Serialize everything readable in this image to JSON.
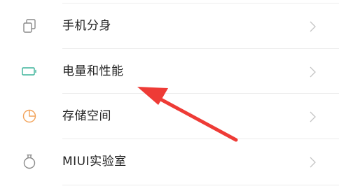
{
  "settings": {
    "items": [
      {
        "label": "手机分身",
        "icon": "clone-icon",
        "icon_color": "#8a8a8a"
      },
      {
        "label": "电量和性能",
        "icon": "battery-icon",
        "icon_color": "#3cb39a"
      },
      {
        "label": "存储空间",
        "icon": "pie-chart-icon",
        "icon_color": "#f2a35a"
      },
      {
        "label": "MIUI实验室",
        "icon": "flask-icon",
        "icon_color": "#8a8a8a"
      }
    ]
  },
  "annotation": {
    "arrow_color": "#ee3b36"
  },
  "colors": {
    "text": "#222222",
    "chevron": "#c4c4c4",
    "divider": "#ececec"
  }
}
